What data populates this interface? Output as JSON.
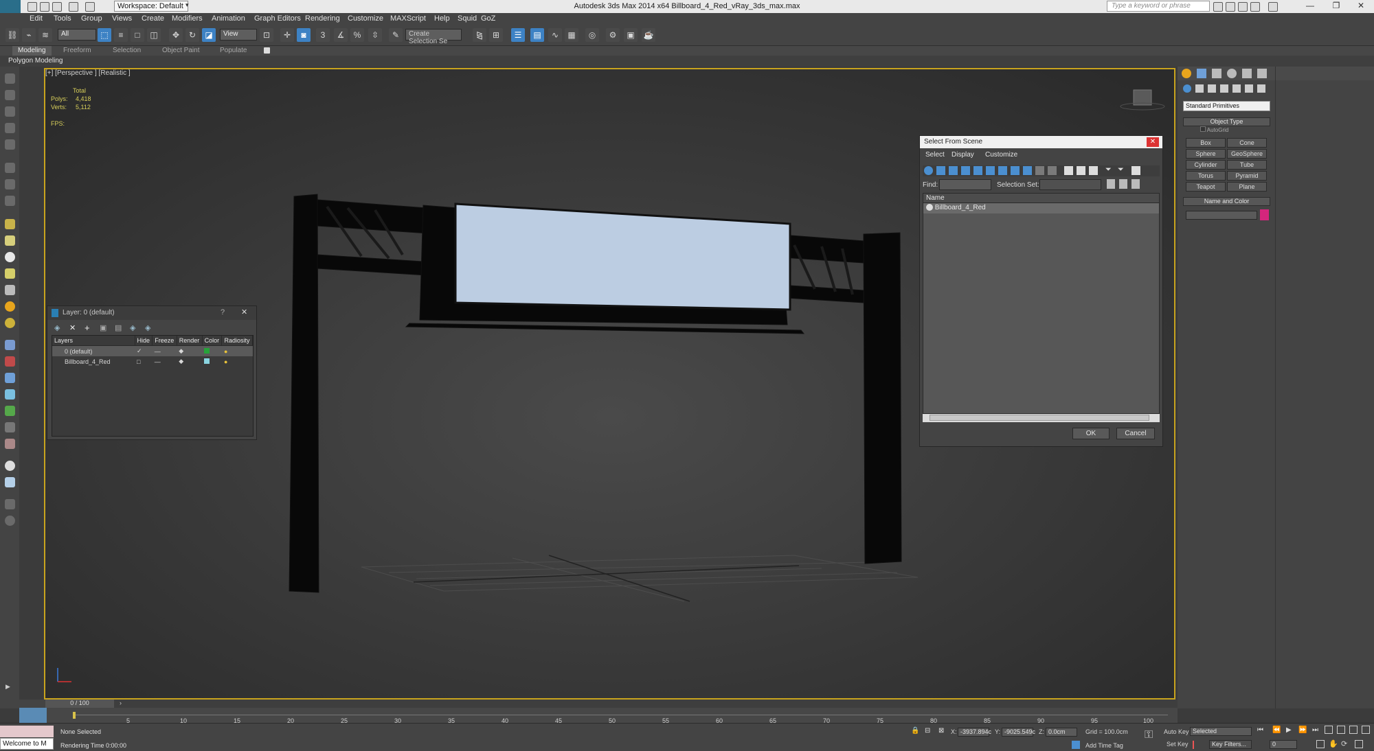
{
  "window": {
    "title": "Autodesk 3ds Max  2014 x64    Billboard_4_Red_vRay_3ds_max.max",
    "workspace": "Workspace: Default",
    "search_placeholder": "Type a keyword or phrase"
  },
  "menu": [
    "Edit",
    "Tools",
    "Group",
    "Views",
    "Create",
    "Modifiers",
    "Animation",
    "Graph Editors",
    "Rendering",
    "Customize",
    "MAXScript",
    "Help",
    "Squid",
    "GoZ"
  ],
  "toolbar": {
    "filter": "All",
    "ref_coord": "View",
    "selection_set": "Create Selection Se"
  },
  "ribbon": {
    "tabs": [
      "Modeling",
      "Freeform",
      "Selection",
      "Object Paint",
      "Populate"
    ],
    "subtitle": "Polygon Modeling"
  },
  "viewport": {
    "label": "[+] [Perspective ] [Realistic ]",
    "stats": {
      "header": "Total",
      "polys_label": "Polys:",
      "polys": "4,418",
      "verts_label": "Verts:",
      "verts": "5,112",
      "fps_label": "FPS:"
    }
  },
  "layer_dialog": {
    "title": "Layer: 0 (default)",
    "columns": [
      "Layers",
      "Hide",
      "Freeze",
      "Render",
      "Color",
      "Radiosity"
    ],
    "rows": [
      {
        "name": "0 (default)",
        "color": "#27a33a"
      },
      {
        "name": "Billboard_4_Red",
        "color": "#8ad4e0"
      }
    ]
  },
  "select_scene": {
    "title": "Select From Scene",
    "menu": [
      "Select",
      "Display",
      "Customize"
    ],
    "find_label": "Find:",
    "selection_set_label": "Selection Set:",
    "column": "Name",
    "items": [
      "Billboard_4_Red"
    ],
    "ok": "OK",
    "cancel": "Cancel"
  },
  "command_panel": {
    "dropdown": "Standard Primitives",
    "object_type": "Object Type",
    "autogrid": "AutoGrid",
    "buttons": [
      "Box",
      "Cone",
      "Sphere",
      "GeoSphere",
      "Cylinder",
      "Tube",
      "Torus",
      "Pyramid",
      "Teapot",
      "Plane"
    ],
    "name_and_color": "Name and Color",
    "swatch_color": "#d4267c"
  },
  "timeline": {
    "frame": "0 / 100",
    "ticks": [
      "5",
      "10",
      "15",
      "20",
      "25",
      "30",
      "35",
      "40",
      "45",
      "50",
      "55",
      "60",
      "65",
      "70",
      "75",
      "80",
      "85",
      "90",
      "95",
      "100"
    ]
  },
  "status": {
    "welcome": "Welcome to M",
    "selected": "None Selected",
    "render_time": "Rendering Time  0:00:00",
    "x_label": "X:",
    "x": "-3937.894c",
    "y_label": "Y:",
    "y": "-9025.549c",
    "z_label": "Z:",
    "z": "0.0cm",
    "grid": "Grid = 100.0cm",
    "add_time_tag": "Add Time Tag",
    "auto_key": "Auto Key",
    "auto_key_value": "Selected",
    "set_key": "Set Key",
    "key_filters": "Key Filters...",
    "frame_field": "0"
  }
}
